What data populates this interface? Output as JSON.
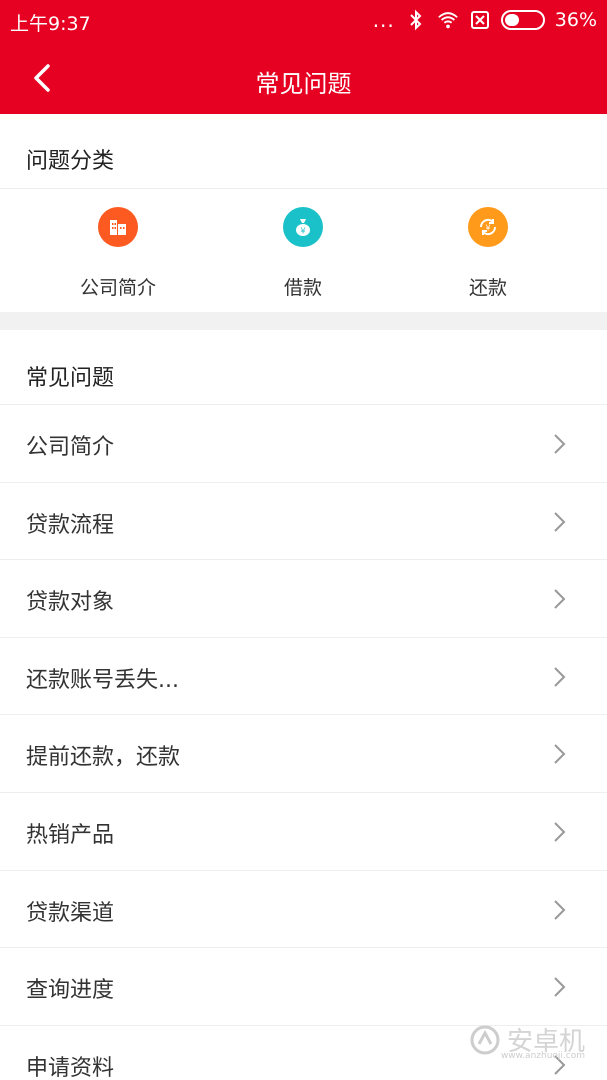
{
  "status": {
    "time": "上午9:37",
    "dots": "...",
    "battery": "36%"
  },
  "nav": {
    "title": "常见问题"
  },
  "categories": {
    "title": "问题分类",
    "items": [
      {
        "label": "公司简介",
        "color": "#fc5a20"
      },
      {
        "label": "借款",
        "color": "#1ac1c8"
      },
      {
        "label": "还款",
        "color": "#ff9a1a"
      }
    ]
  },
  "faq": {
    "title": "常见问题",
    "items": [
      "公司简介",
      "贷款流程",
      "贷款对象",
      "还款账号丢失...",
      "提前还款，还款",
      "热销产品",
      "贷款渠道",
      "查询进度",
      "申请资料"
    ]
  },
  "watermark": {
    "brand": "安卓机",
    "url": "www.anzhuoji.com"
  },
  "colors": {
    "brand_red": "#e60022"
  }
}
